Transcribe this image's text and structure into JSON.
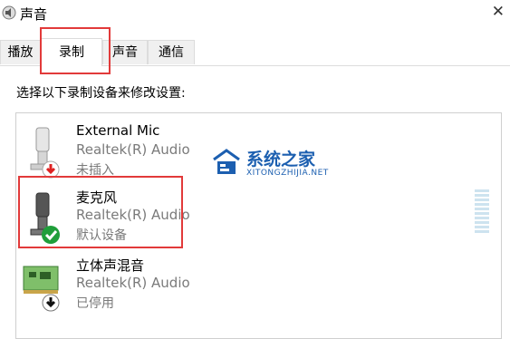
{
  "window": {
    "title": "声音"
  },
  "tabs": [
    {
      "label": "播放"
    },
    {
      "label": "录制",
      "active": true
    },
    {
      "label": "声音"
    },
    {
      "label": "通信"
    }
  ],
  "instruction": "选择以下录制设备来修改设置:",
  "devices": [
    {
      "name": "External Mic",
      "driver": "Realtek(R) Audio",
      "status": "未插入",
      "icon": "microphone-icon",
      "badge": "unplugged-red-arrow"
    },
    {
      "name": "麦克风",
      "driver": "Realtek(R) Audio",
      "status": "默认设备",
      "icon": "microphone-icon",
      "badge": "default-green-check"
    },
    {
      "name": "立体声混音",
      "driver": "Realtek(R) Audio",
      "status": "已停用",
      "icon": "sound-card-icon",
      "badge": "disabled-black-arrow"
    }
  ],
  "watermark": {
    "text": "系统之家",
    "sub": "XITONGZHIJIA.NET"
  },
  "colors": {
    "highlight": "#e23a3a",
    "accent_blue": "#1c5fb0",
    "check_green": "#1f9e3a"
  }
}
